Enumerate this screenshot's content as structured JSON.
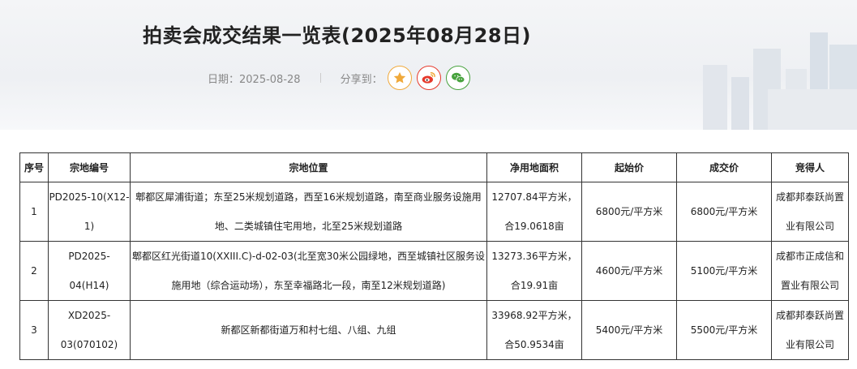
{
  "header": {
    "title": "拍卖会成交结果一览表(2025年08月28日)",
    "date_label": "日期：2025-08-28",
    "share_label": "分享到："
  },
  "share": {
    "icons": [
      "star-icon",
      "weibo-icon",
      "wechat-icon"
    ],
    "colors": {
      "favorite": "#f0a93a",
      "weibo": "#e6392b",
      "wechat": "#47a23d"
    }
  },
  "table": {
    "headers": [
      "序号",
      "宗地编号",
      "宗地位置",
      "净用地面积",
      "起始价",
      "成交价",
      "竞得人"
    ],
    "rows": [
      {
        "index": "1",
        "parcel_no": "PD2025-10(X12-1)",
        "location": "郫都区犀浦街道；东至25米规划道路，西至16米规划道路，南至商业服务设施用地、二类城镇住宅用地，北至25米规划道路",
        "area": "12707.84平方米，合19.0618亩",
        "start_price": "6800元/平方米",
        "deal_price": "6800元/平方米",
        "winner": "成都邦泰跃尚置业有限公司"
      },
      {
        "index": "2",
        "parcel_no": "PD2025-04(H14)",
        "location": "郫都区红光街道10(XXIII.C)-d-02-03(北至宽30米公园绿地，西至城镇社区服务设施用地（综合运动场），东至幸福路北一段，南至12米规划道路)",
        "area": "13273.36平方米，合19.91亩",
        "start_price": "4600元/平方米",
        "deal_price": "5100元/平方米",
        "winner": "成都市正成信和置业有限公司"
      },
      {
        "index": "3",
        "parcel_no": "XD2025-03(070102)",
        "location": "新都区新都街道万和村七组、八组、九组",
        "area": "33968.92平方米，合50.9534亩",
        "start_price": "5400元/平方米",
        "deal_price": "5500元/平方米",
        "winner": "成都邦泰跃尚置业有限公司"
      }
    ]
  }
}
